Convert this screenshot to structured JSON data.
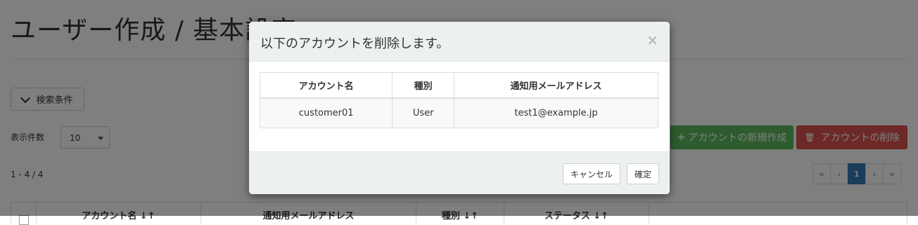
{
  "page": {
    "title": "ユーザー作成 / 基本設定",
    "search_toggle_label": "検索条件",
    "page_size_label": "表示件数",
    "page_size_value": "10",
    "range_text": "1 - 4 / 4",
    "create_button_label": "アカウントの新規作成",
    "delete_button_label": "アカウントの削除",
    "create_icon": "plus-icon",
    "delete_icon": "trash-icon",
    "pagination": {
      "first": "«",
      "prev": "‹",
      "current": "1",
      "next": "›",
      "last": "»"
    },
    "table_headers": [
      "アカウント名 ↓↑",
      "通知用メールアドレス",
      "種別 ↓↑",
      "ステータス ↓↑"
    ]
  },
  "modal": {
    "title": "以下のアカウントを削除します。",
    "close_glyph": "×",
    "columns": [
      "アカウント名",
      "種別",
      "通知用メールアドレス"
    ],
    "rows": [
      {
        "account": "customer01",
        "type": "User",
        "email": "test1@example.jp"
      }
    ],
    "cancel_label": "キャンセル",
    "confirm_label": "確定"
  },
  "colors": {
    "success": "#5cb85c",
    "danger": "#d9534f",
    "primary": "#337ab7",
    "modal_band": "#ecf0f1"
  }
}
